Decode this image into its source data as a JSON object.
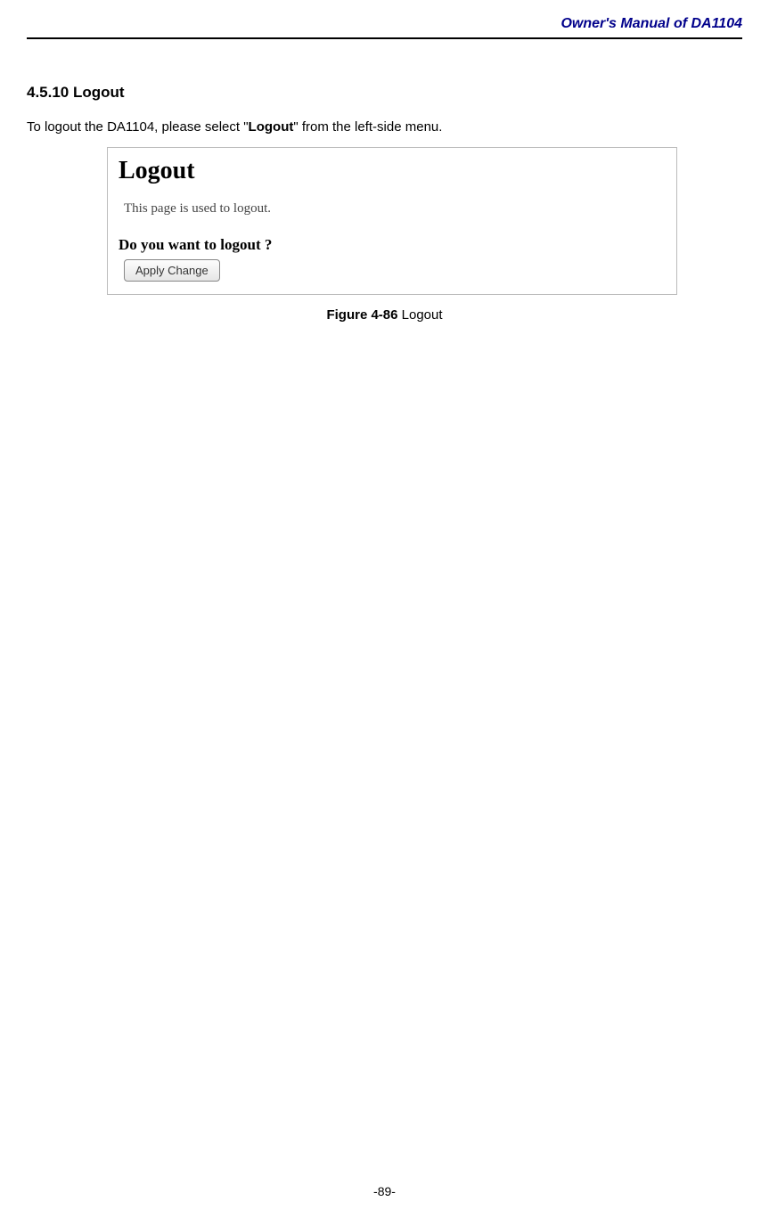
{
  "header": {
    "title": "Owner's Manual of DA1104"
  },
  "section": {
    "heading": "4.5.10 Logout",
    "intro_prefix": "To logout the DA1104, please select \"",
    "intro_bold": "Logout",
    "intro_suffix": "\" from the left-side menu."
  },
  "screenshot": {
    "title": "Logout",
    "description": "This page is used to logout.",
    "question": "Do you want to logout ?",
    "button_label": "Apply Change"
  },
  "figure": {
    "label": "Figure 4-86",
    "caption": " Logout"
  },
  "footer": {
    "page_number": "-89-"
  }
}
